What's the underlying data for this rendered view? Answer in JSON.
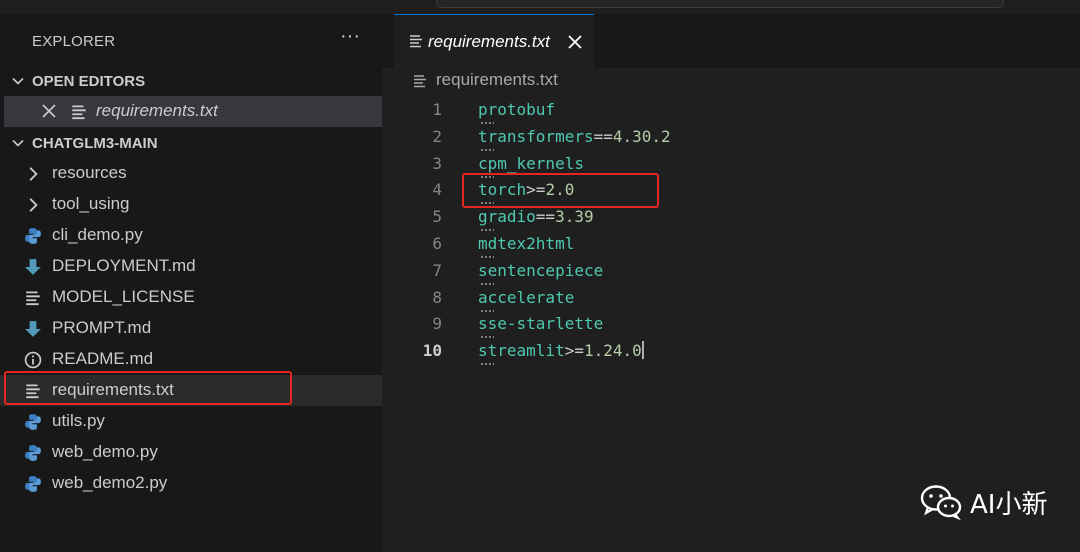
{
  "explorer": {
    "title": "EXPLORER",
    "more_label": "···"
  },
  "open_editors": {
    "header": "OPEN EDITORS",
    "items": [
      {
        "name": "requirements.txt",
        "icon": "lines-icon"
      }
    ]
  },
  "project": {
    "header": "CHATGLM3-MAIN",
    "items": [
      {
        "name": "resources",
        "icon": "chevron-right-icon",
        "kind": "folder"
      },
      {
        "name": "tool_using",
        "icon": "chevron-right-icon",
        "kind": "folder"
      },
      {
        "name": "cli_demo.py",
        "icon": "python-icon",
        "kind": "file"
      },
      {
        "name": "DEPLOYMENT.md",
        "icon": "markdown-icon",
        "kind": "file"
      },
      {
        "name": "MODEL_LICENSE",
        "icon": "lines-icon",
        "kind": "file"
      },
      {
        "name": "PROMPT.md",
        "icon": "markdown-icon",
        "kind": "file"
      },
      {
        "name": "README.md",
        "icon": "info-icon",
        "kind": "file"
      },
      {
        "name": "requirements.txt",
        "icon": "lines-icon",
        "kind": "file",
        "selected": true
      },
      {
        "name": "utils.py",
        "icon": "python-icon",
        "kind": "file"
      },
      {
        "name": "web_demo.py",
        "icon": "python-icon",
        "kind": "file"
      },
      {
        "name": "web_demo2.py",
        "icon": "python-icon",
        "kind": "file"
      }
    ]
  },
  "editor": {
    "tab_label": "requirements.txt",
    "breadcrumb": "requirements.txt",
    "active_line": 10,
    "lines": [
      {
        "n": "1",
        "pkg": "protobuf",
        "op": "",
        "ver": ""
      },
      {
        "n": "2",
        "pkg": "transformers",
        "op": "==",
        "ver": "4.30.2"
      },
      {
        "n": "3",
        "pkg": "cpm_kernels",
        "op": "",
        "ver": ""
      },
      {
        "n": "4",
        "pkg": "torch",
        "op": ">=",
        "ver": "2.0"
      },
      {
        "n": "5",
        "pkg": "gradio",
        "op": "==",
        "ver": "3.39"
      },
      {
        "n": "6",
        "pkg": "mdtex2html",
        "op": "",
        "ver": ""
      },
      {
        "n": "7",
        "pkg": "sentencepiece",
        "op": "",
        "ver": ""
      },
      {
        "n": "8",
        "pkg": "accelerate",
        "op": "",
        "ver": ""
      },
      {
        "n": "9",
        "pkg": "sse-starlette",
        "op": "",
        "ver": ""
      },
      {
        "n": "10",
        "pkg": "streamlit",
        "op": ">=",
        "ver": "1.24.0"
      }
    ]
  },
  "watermark": {
    "text": "AI小新",
    "icon": "wechat-icon"
  },
  "colors": {
    "highlight_box": "#e3261f",
    "package": "#4ec9b0",
    "version": "#b5cea8"
  }
}
